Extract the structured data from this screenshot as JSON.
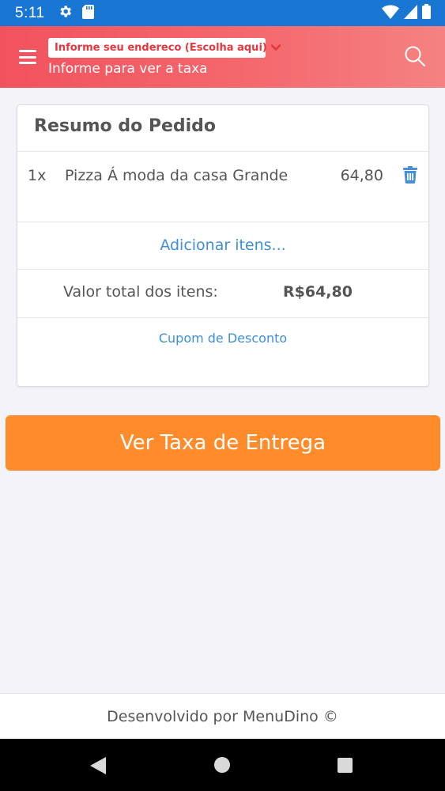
{
  "status_bar": {
    "time": "5:11",
    "icons": [
      "gear-icon",
      "sd-card-icon",
      "wifi-icon",
      "signal-icon",
      "battery-icon"
    ]
  },
  "header": {
    "address_select_label": "Informe seu endereco (Escolha aqui)",
    "subtitle": "Informe para ver a taxa",
    "accent_color": "#f2525d"
  },
  "order_summary": {
    "title": "Resumo do Pedido",
    "items": [
      {
        "qty": "1x",
        "name": "Pizza Á moda da casa Grande",
        "price": "64,80"
      }
    ],
    "add_items_label": "Adicionar itens...",
    "total_label": "Valor total dos itens:",
    "total_value": "R$64,80",
    "coupon_label": "Cupom de Desconto"
  },
  "cta": {
    "label": "Ver Taxa de Entrega",
    "color": "#ff8b2b"
  },
  "footer": {
    "text": "Desenvolvido por MenuDino ©"
  },
  "link_color": "#3f8fd8"
}
